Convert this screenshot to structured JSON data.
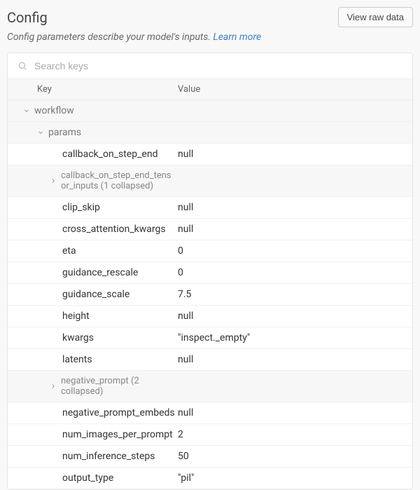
{
  "header": {
    "title": "Config",
    "view_raw": "View raw data"
  },
  "description": {
    "text": "Config parameters describe your model's inputs. ",
    "learn_more": "Learn more"
  },
  "search": {
    "placeholder": "Search keys"
  },
  "columns": {
    "key": "Key",
    "value": "Value"
  },
  "tree": {
    "workflow_label": "workflow",
    "params_label": "params",
    "collapsed1": "callback_on_step_end_tensor_inputs (1 collapsed)",
    "collapsed2": "negative_prompt (2 collapsed)",
    "entries": {
      "callback_on_step_end": {
        "k": "callback_on_step_end",
        "v": "null"
      },
      "clip_skip": {
        "k": "clip_skip",
        "v": "null"
      },
      "cross_attention_kwargs": {
        "k": "cross_attention_kwargs",
        "v": "null"
      },
      "eta": {
        "k": "eta",
        "v": "0"
      },
      "guidance_rescale": {
        "k": "guidance_rescale",
        "v": "0"
      },
      "guidance_scale": {
        "k": "guidance_scale",
        "v": "7.5"
      },
      "height": {
        "k": "height",
        "v": "null"
      },
      "kwargs": {
        "k": "kwargs",
        "v": "\"inspect._empty\""
      },
      "latents": {
        "k": "latents",
        "v": "null"
      },
      "negative_prompt_embeds": {
        "k": "negative_prompt_embeds",
        "v": "null"
      },
      "num_images_per_prompt": {
        "k": "num_images_per_prompt",
        "v": "2"
      },
      "num_inference_steps": {
        "k": "num_inference_steps",
        "v": "50"
      },
      "output_type": {
        "k": "output_type",
        "v": "\"pil\""
      }
    }
  }
}
